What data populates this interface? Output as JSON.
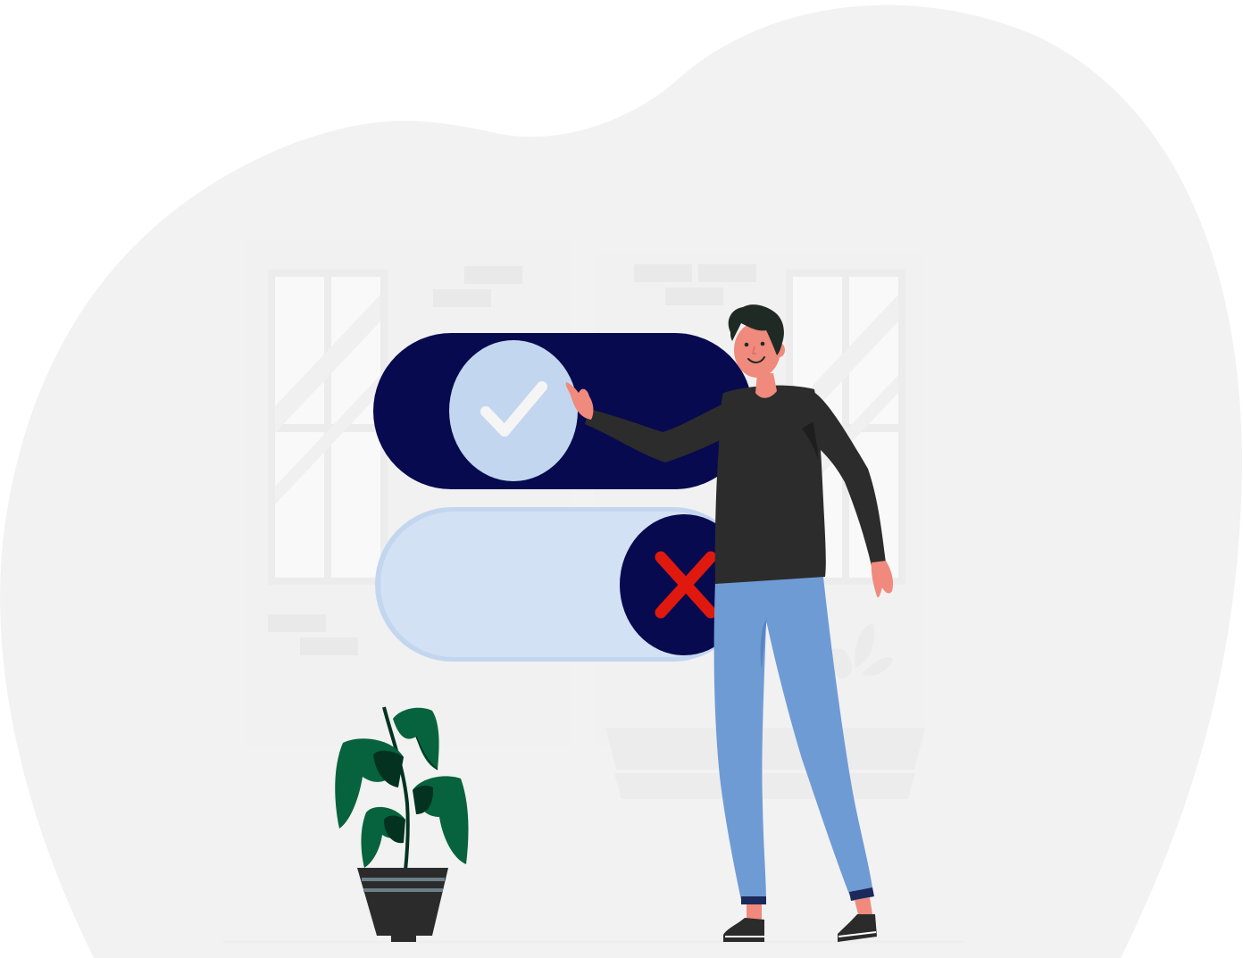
{
  "scene": {
    "description_icons": [
      "check-icon",
      "close-icon"
    ],
    "colors": {
      "background_blob": "#f2f2f2",
      "window_frame": "#ececec",
      "window_glass": "#f8f8f8",
      "toggle_on_track": "#070a4f",
      "toggle_on_knob": "#c3d6ef",
      "toggle_off_track": "#d3e1f4",
      "toggle_off_knob": "#070a4f",
      "check_mark": "#f5f5f5",
      "cross_mark": "#e0190f",
      "shirt": "#2c2c2c",
      "jeans": "#6f9bd5",
      "skin": "#ef8a7c",
      "hair": "#1f2a24",
      "plant_leaf": "#06633e",
      "plant_leaf_dark": "#043221",
      "pot": "#2b2b2b"
    }
  },
  "toggles": [
    {
      "state": "on",
      "icon": "check-icon"
    },
    {
      "state": "off",
      "icon": "close-icon"
    }
  ]
}
